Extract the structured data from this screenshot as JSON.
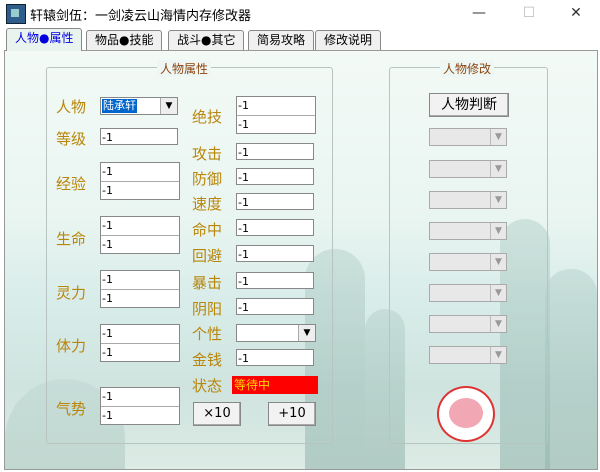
{
  "window": {
    "title": "轩辕剑伍：一剑凌云山海情内存修改器",
    "minimize": "—",
    "maximize": "☐",
    "close": "✕"
  },
  "tabs": [
    "人物●属性",
    "物品●技能",
    "战斗●其它",
    "简易攻略",
    "修改说明"
  ],
  "attr_group": {
    "title": "人物属性",
    "character_label": "人物",
    "character_value": "陆承轩",
    "level_label": "等级",
    "level": "-1",
    "exp_label": "经验",
    "exp": [
      "-1",
      "-1"
    ],
    "hp_label": "生命",
    "hp": [
      "-1",
      "-1"
    ],
    "mp_label": "灵力",
    "mp": [
      "-1",
      "-1"
    ],
    "stamina_label": "体力",
    "stamina": [
      "-1",
      "-1"
    ],
    "momentum_label": "气势",
    "momentum": [
      "-1",
      "-1"
    ],
    "skill_label": "绝技",
    "skill": [
      "-1",
      "-1"
    ],
    "attack_label": "攻击",
    "attack": "-1",
    "defense_label": "防御",
    "defense": "-1",
    "speed_label": "速度",
    "speed": "-1",
    "hit_label": "命中",
    "hit": "-1",
    "evade_label": "回避",
    "evade": "-1",
    "crit_label": "暴击",
    "crit": "-1",
    "yinyang_label": "阴阳",
    "yinyang": "-1",
    "personality_label": "个性",
    "personality": "",
    "money_label": "金钱",
    "money": "-1",
    "state_label": "状态",
    "state": "等待中",
    "x10_button": "×10",
    "plus10_button": "+10"
  },
  "modify_group": {
    "title": "人物修改",
    "judge_button": "人物判断"
  },
  "colors": {
    "label": "#b8860b",
    "status_bg": "#ff0000",
    "status_text": "#ffd700",
    "active_tab": "#0000e0"
  }
}
